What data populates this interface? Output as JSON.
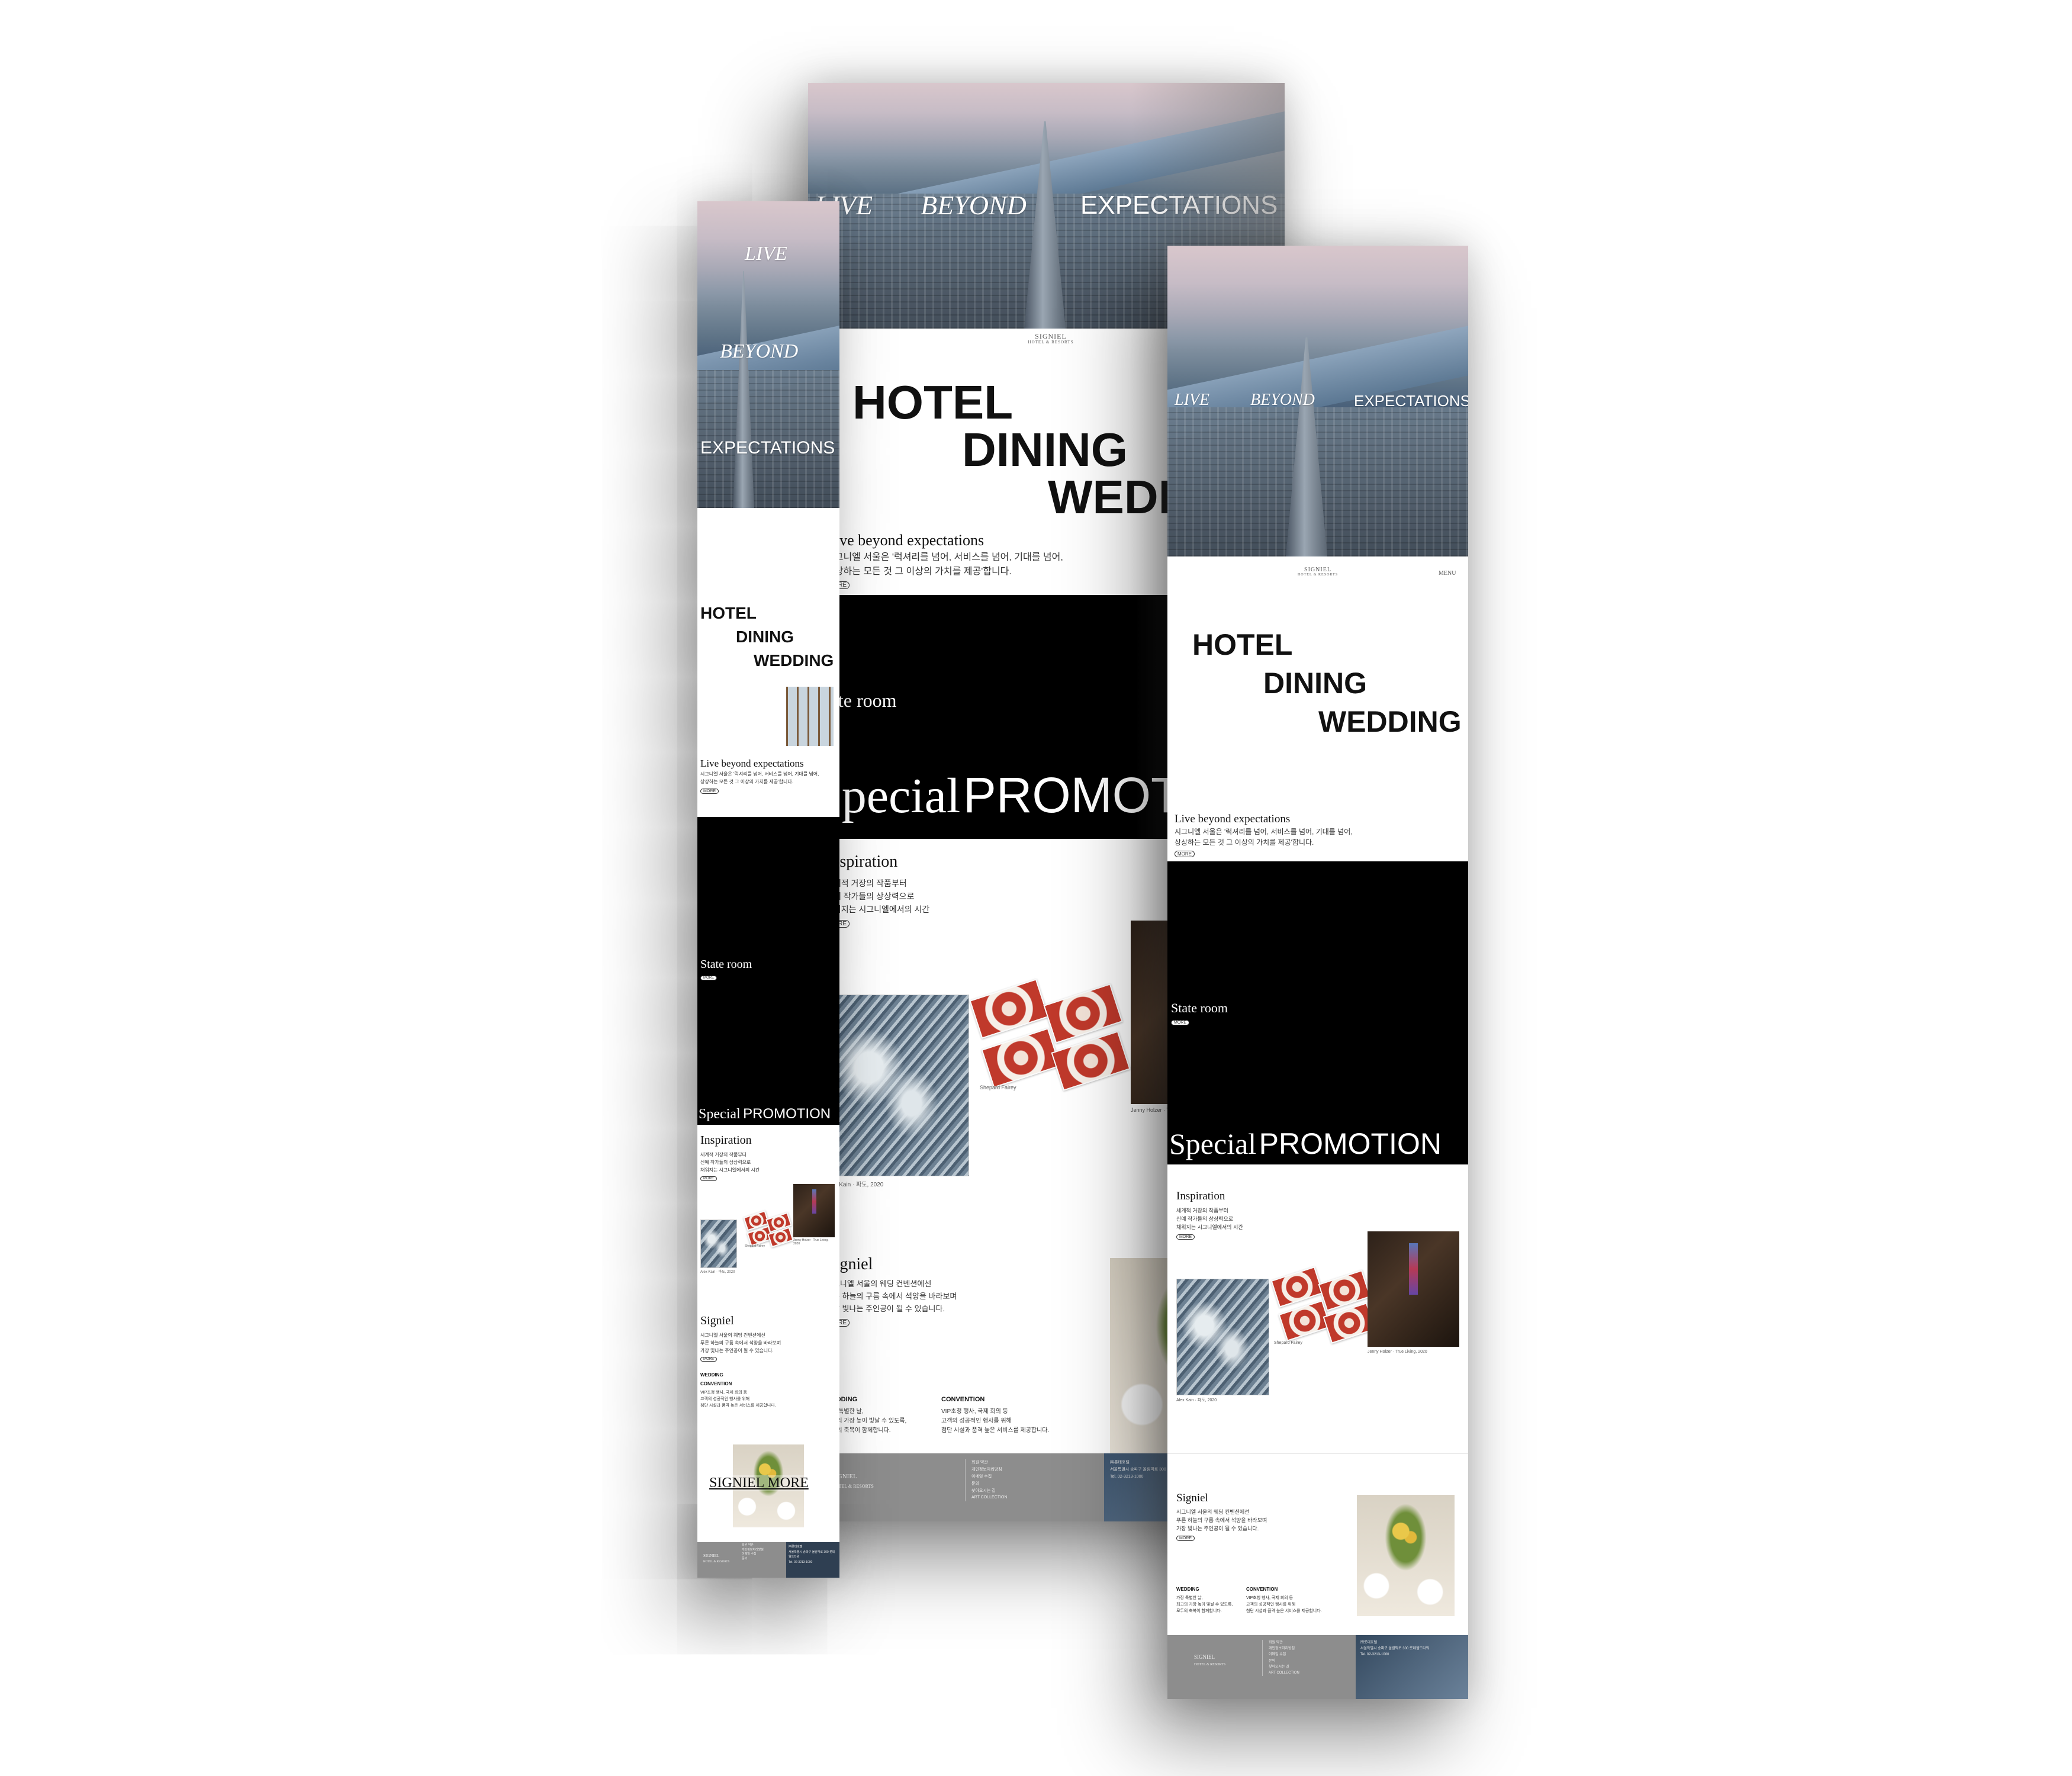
{
  "hero": {
    "live": "LIVE",
    "beyond": "BEYOND",
    "expectations": "EXPECTATIONS"
  },
  "brand": {
    "logo_line1": "SIGNIEL",
    "logo_line2": "HOTEL & RESORTS"
  },
  "nav": {
    "menu_label": "MENU"
  },
  "categories": {
    "hotel": "HOTEL",
    "dining": "DINING",
    "wedding": "WEDDING"
  },
  "intro": {
    "heading": "Live beyond expectations",
    "body_line1": "시그니엘 서울은 '럭셔리를 넘어, 서비스를 넘어, 기대를 넘어,",
    "body_line2": "상상하는 모든 것 그 이상의 가치를 제공'합니다.",
    "more": "MORE"
  },
  "state_room": {
    "title": "State room",
    "more": "MORE"
  },
  "promotion": {
    "special": "Special",
    "promotion": "PROMOTION"
  },
  "inspiration": {
    "title": "Inspiration",
    "line1": "세계적 거장의 작품부터",
    "line2": "신예 작가들의 상상력으로",
    "line3": "채워지는 시그니엘에서의 시간",
    "more": "MORE",
    "caption_wave": "Alex Kain · 파도, 2020",
    "caption_tiles": "Shepard Fairey",
    "caption_dark": "Jenny Holzer · True Living, 2020"
  },
  "signiel": {
    "title": "Signiel",
    "line1": "시그니엘 서울의 웨딩 컨벤션에선",
    "line2": "푸른 하늘의 구름 속에서 석양을 바라보며",
    "line3": "가장 빛나는 주인공이 될 수 있습니다.",
    "more": "MORE",
    "wedding_title": "WEDDING",
    "wedding_line1": "가장 특별한 날,",
    "wedding_line2": "최고의 가장 높이 빛날 수 있도록,",
    "wedding_line3": "모두의 축복이 함께합니다.",
    "convention_title": "CONVENTION",
    "convention_line1": "VIP초청 행사, 국제 회의 등",
    "convention_line2": "고객의 성공적인 행사를 위해",
    "convention_line3": "첨단 시설과 품격 높은 서비스를 제공합니다.",
    "signiel_more": "SIGNIEL MORE"
  },
  "footer": {
    "logo_line1": "SIGNIEL",
    "logo_line2": "HOTEL & RESORTS",
    "links": [
      "회원 약관",
      "개인정보처리방침",
      "이메일 수집",
      "문의",
      "찾아오시는 길",
      "ART COLLECTION"
    ],
    "info_title": "㈜롯데호텔",
    "info_line1": "서울특별시 송파구 올림픽로 300 롯데월드타워",
    "info_line2": "Tel. 02-3213-1000"
  }
}
